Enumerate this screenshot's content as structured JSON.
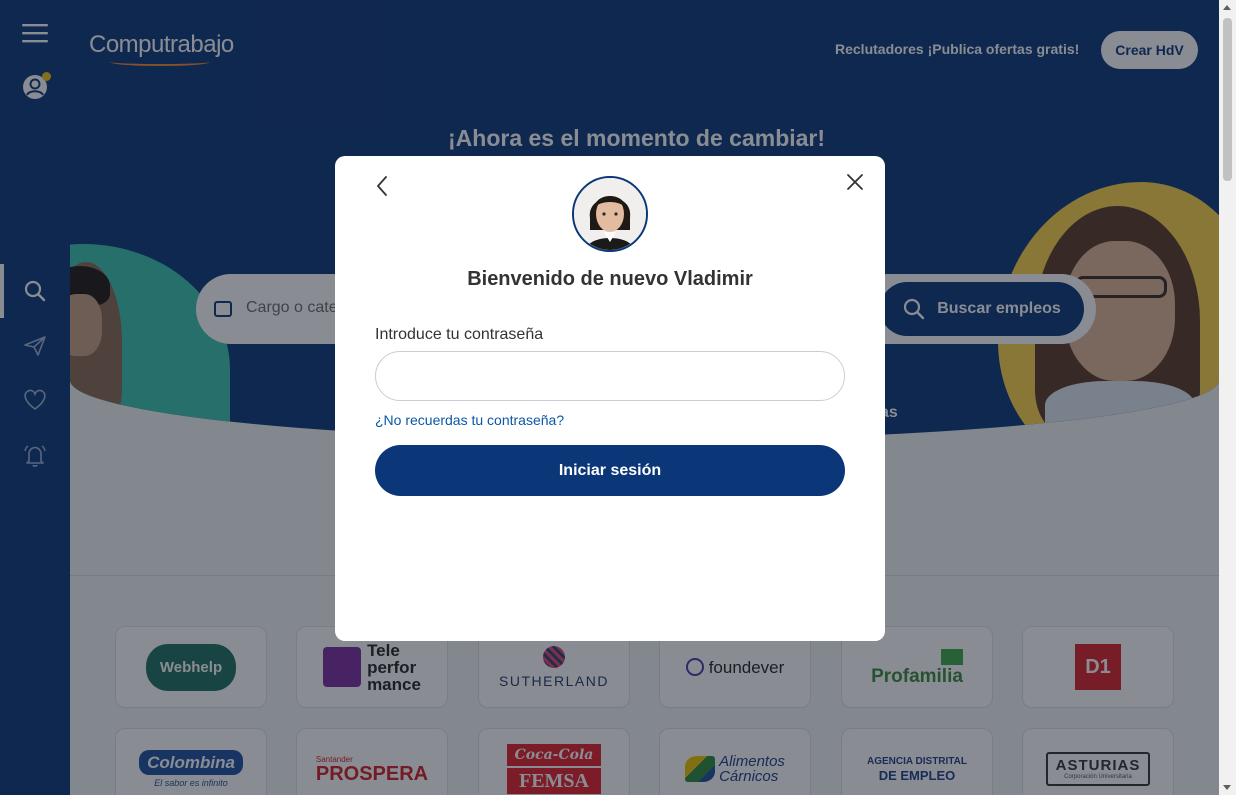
{
  "brand": {
    "name": "Computrabajo",
    "primary_color": "#0b3779",
    "accent_color": "#f28a2c"
  },
  "header": {
    "recruiters_link": "Reclutadores ¡Publica ofertas gratis!",
    "create_cv_button": "Crear HdV"
  },
  "sidebar": {
    "items": [
      {
        "icon": "menu-icon"
      },
      {
        "icon": "user-profile-icon"
      },
      {
        "icon": "search-icon",
        "active": true
      },
      {
        "icon": "send-icon"
      },
      {
        "icon": "heart-icon"
      },
      {
        "icon": "bell-icon"
      }
    ]
  },
  "hero": {
    "title": "¡Ahora es el momento de cambiar!",
    "search_placeholder": "Cargo o cate",
    "search_button": "Buscar empleos",
    "partial_text": "as"
  },
  "company_logos": [
    {
      "name": "Webhelp"
    },
    {
      "name": "Teleperformance",
      "lines": [
        "Tele",
        "perfor",
        "mance"
      ]
    },
    {
      "name": "SUTHERLAND"
    },
    {
      "name": "foundever"
    },
    {
      "name": "Profamilia"
    },
    {
      "name": "D1"
    },
    {
      "name": "Colombina",
      "tagline": "El sabor es infinito"
    },
    {
      "name": "Santander PROSPERA",
      "lines": [
        "Santander",
        "PROSPERA"
      ]
    },
    {
      "name": "Coca-Cola FEMSA",
      "lines": [
        "Coca-Cola",
        "FEMSA"
      ]
    },
    {
      "name": "Alimentos Cárnicos",
      "lines": [
        "Alimentos",
        "Cárnicos"
      ]
    },
    {
      "name": "Agencia Distrital de Empleo",
      "lines": [
        "AGENCIA DISTRITAL",
        "DE EMPLEO"
      ]
    },
    {
      "name": "ASTURIAS",
      "tagline": "Corporación Universitaria"
    }
  ],
  "modal": {
    "welcome": "Bienvenido de nuevo Vladimir",
    "password_label": "Introduce tu contraseña",
    "password_value": "",
    "forgot_link": "¿No recuerdas tu contraseña?",
    "login_button": "Iniciar sesión"
  }
}
